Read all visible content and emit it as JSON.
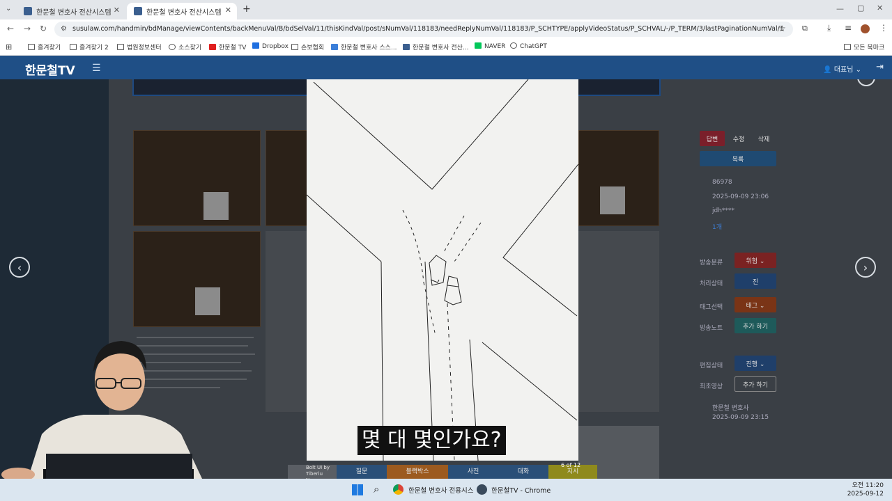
{
  "browser": {
    "tabs": [
      {
        "title": "한문철 변호사 전산시스템",
        "active": false
      },
      {
        "title": "한문철 변호사 전산시스템",
        "active": true
      }
    ],
    "new_tab": "+",
    "url": "susulaw.com/handmin/bdManage/viewContents/backMenuVal/B/bdSelVal/11/thisKindVal/post/sNumVal/118183/needReplyNumVal/118183/P_SCHTYPE/applyVideoStatus/P_SCHVAL/-/P_TERM/3/lastPaginationNumVal/1",
    "bookmarks": [
      "즐겨찾기",
      "즐겨찾기 2",
      "법원정보센터",
      "소스찾기",
      "한문철 TV",
      "Dropbox",
      "손보협회",
      "한문철 변호사 스스...",
      "한문철 변호사 전산...",
      "NAVER",
      "ChatGPT"
    ],
    "all_bookmarks": "모든 북마크"
  },
  "app": {
    "logo": "한문철TV",
    "user": "대표님",
    "user_caret": "⌄"
  },
  "right_panel": {
    "buttons_top": [
      "답변",
      "수정",
      "삭제"
    ],
    "list_button": "목록",
    "meta": [
      "86978",
      "2025-09-09 23:06",
      "jdh****",
      "1개"
    ],
    "rows": [
      {
        "label": "방송분류",
        "value": "위험 ⌄"
      },
      {
        "label": "처리상태",
        "value": "진"
      },
      {
        "label": "태그선택",
        "value": "태그 ⌄"
      },
      {
        "label": "방송노트",
        "value": "추가 하기"
      },
      {
        "label": "편집상태",
        "value": "진행 ⌄"
      },
      {
        "label": "최초영상",
        "value": "추가 하기"
      }
    ],
    "author": "한문철 변호사",
    "author_date": "2025-09-09 23:15"
  },
  "viewer": {
    "subtitle": "몇 대 몇인가요?",
    "counter": "6 of 12",
    "credit": "Bolt UI by Tiberiu Neamu"
  },
  "bottom_tabs": [
    "질문",
    "블랙박스",
    "사진",
    "대화",
    "지시"
  ],
  "taskbar": {
    "items": [
      "한문철 변호사 전용시스",
      "한문철TV - Chrome"
    ],
    "time": "오전 11:20",
    "date": "2025-09-12"
  },
  "colors": {
    "appbar": "#1f4f86",
    "bg_dim": "#1e2a36",
    "tab_blue": "#2a4f78",
    "tab_orange": "#9c5a1f",
    "tab_yellow": "#8f8a1c"
  }
}
